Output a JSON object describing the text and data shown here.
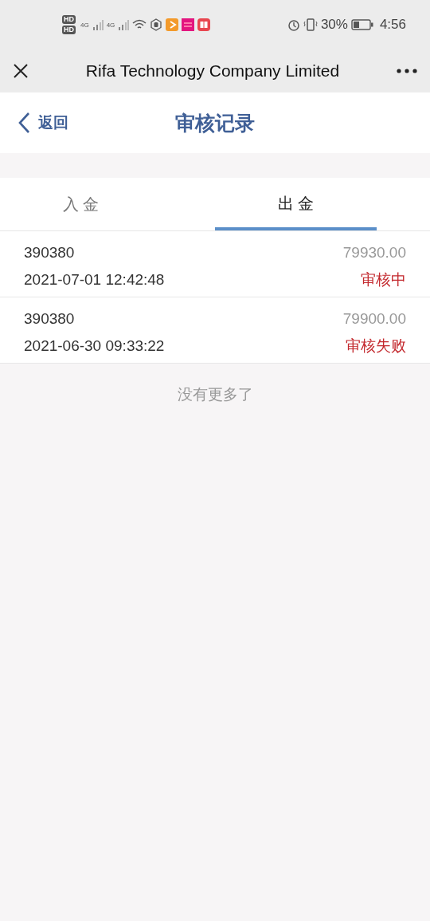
{
  "status_bar": {
    "sim_labels": [
      "HD",
      "HD"
    ],
    "network_labels": [
      "4G",
      "4G"
    ],
    "battery_percent": "30%",
    "time": "4:56"
  },
  "browser_bar": {
    "title": "Rifa Technology Company Limited"
  },
  "header": {
    "back_label": "返回",
    "title": "审核记录"
  },
  "tabs": [
    {
      "label": "入 金",
      "selected": false
    },
    {
      "label": "出 金",
      "selected": true
    }
  ],
  "records": [
    {
      "id": "390380",
      "amount": "79930.00",
      "datetime": "2021-07-01 12:42:48",
      "status": "审核中"
    },
    {
      "id": "390380",
      "amount": "79900.00",
      "datetime": "2021-06-30 09:33:22",
      "status": "审核失败"
    }
  ],
  "footer_note": "没有更多了"
}
